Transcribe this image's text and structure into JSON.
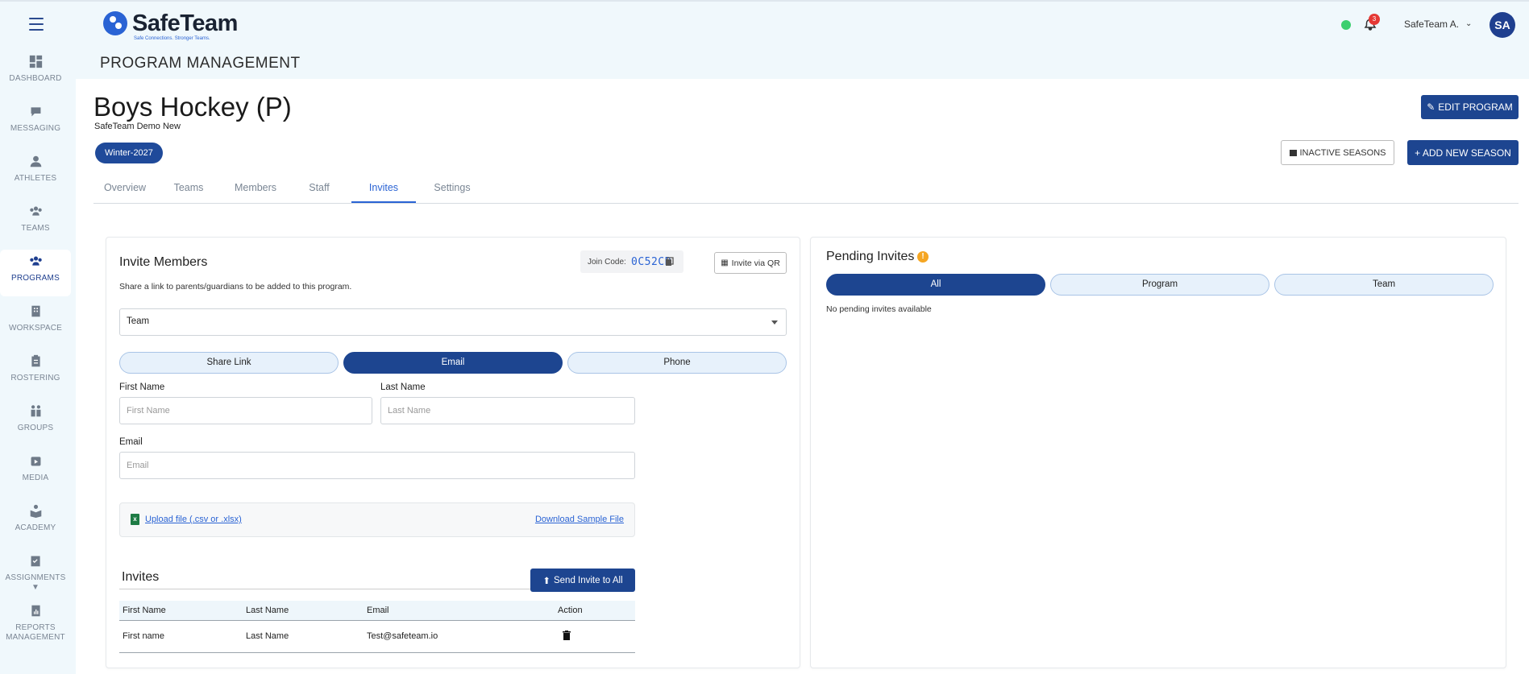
{
  "header": {
    "brand": "SafeTeam",
    "tagline": "Safe Connections. Stronger Teams.",
    "page_heading": "PROGRAM MANAGEMENT",
    "notification_count": "3",
    "user_name": "SafeTeam A.",
    "avatar_initials": "SA",
    "status_color": "#3ccf6f"
  },
  "sidebar": {
    "items": [
      {
        "label": "DASHBOARD",
        "icon": "dashboard-icon"
      },
      {
        "label": "MESSAGING",
        "icon": "messaging-icon"
      },
      {
        "label": "ATHLETES",
        "icon": "athlete-icon"
      },
      {
        "label": "TEAMS",
        "icon": "teams-icon"
      },
      {
        "label": "PROGRAMS",
        "icon": "programs-icon",
        "active": true
      },
      {
        "label": "WORKSPACE",
        "icon": "workspace-icon"
      },
      {
        "label": "ROSTERING",
        "icon": "rostering-icon"
      },
      {
        "label": "GROUPS",
        "icon": "groups-icon"
      },
      {
        "label": "MEDIA",
        "icon": "media-icon"
      },
      {
        "label": "ACADEMY",
        "icon": "academy-icon"
      },
      {
        "label": "ASSIGNMENTS ▼",
        "icon": "assignments-icon"
      },
      {
        "label": "REPORTS MANAGEMENT",
        "icon": "reports-icon"
      }
    ]
  },
  "program": {
    "title": "Boys Hockey (P)",
    "organization": "SafeTeam Demo New",
    "season": "Winter-2027",
    "edit_label": "EDIT PROGRAM",
    "inactive_label": "INACTIVE SEASONS",
    "add_season_label": "+ ADD NEW SEASON"
  },
  "tabs": [
    {
      "label": "Overview"
    },
    {
      "label": "Teams"
    },
    {
      "label": "Members"
    },
    {
      "label": "Staff"
    },
    {
      "label": "Invites",
      "active": true
    },
    {
      "label": "Settings"
    }
  ],
  "invite": {
    "title": "Invite Members",
    "description": "Share a link to parents/guardians to be added to this program.",
    "join_label": "Join Code:",
    "join_code": "0C52CB",
    "qr_label": "Invite via QR",
    "scope_value": "Team",
    "methods": [
      "Share Link",
      "Email",
      "Phone"
    ],
    "active_method": "Email",
    "first_name_label": "First Name",
    "first_name_placeholder": "First Name",
    "last_name_label": "Last Name",
    "last_name_placeholder": "Last Name",
    "email_label": "Email",
    "email_placeholder": "Email",
    "upload_label": "Upload file (.csv or .xlsx)",
    "download_label": "Download Sample File",
    "invites_title": "Invites",
    "send_all_label": "Send Invite to All",
    "table_headers": [
      "First Name",
      "Last Name",
      "Email",
      "Action"
    ],
    "rows": [
      {
        "first": "First name",
        "last": "Last Name",
        "email": "Test@safeteam.io"
      }
    ]
  },
  "pending": {
    "title": "Pending Invites",
    "tabs": [
      "All",
      "Program",
      "Team"
    ],
    "active_tab": "All",
    "empty_text": "No pending invites available"
  },
  "colors": {
    "primary": "#1d4590",
    "accent": "#2a63d4",
    "sidebar_bg": "#f0f8fc",
    "warning": "#f5a623",
    "badge": "#e53935"
  }
}
